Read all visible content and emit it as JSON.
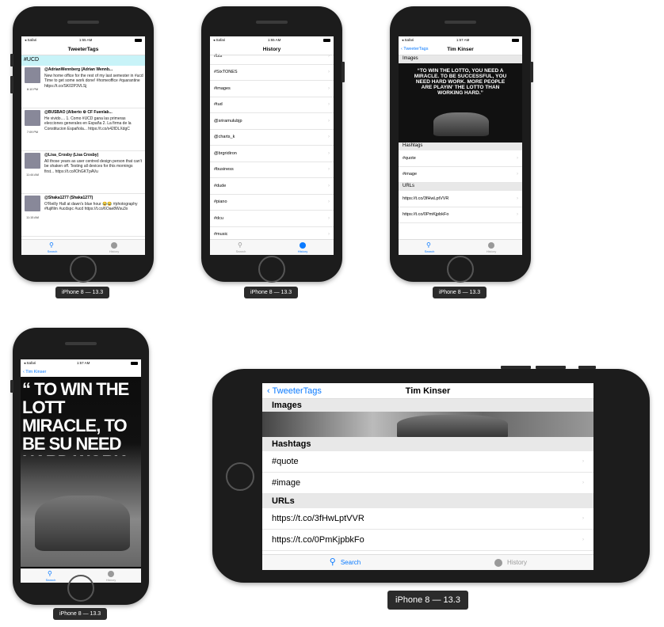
{
  "caption": "iPhone 8 — 13.3",
  "status": {
    "left": "◂ Safari",
    "time1": "1:55 AM",
    "time2": "1:57 AM"
  },
  "tabs": {
    "search": "Search",
    "history": "History"
  },
  "search_screen": {
    "title": "TweeterTags",
    "query": "#UCD",
    "tweets": [
      {
        "user": "@AdrianWennberg (Adrian Wennb...",
        "time": "8:10 PM",
        "text": "New home office for the rest of my last semester in #ucd Time to get some work done! #homeoffice #quarantine https://t.co/SK02P3VLSj"
      },
      {
        "user": "@BUSBAO (Alberto ⚙ CF Fuenlab...",
        "time": "7:09 PM",
        "text": "He vivido.... 1. Como #UCD gana las primeras elecciones generales en España 2. La firma de la Constitucion Española... https://t.co/x42lDLXdgC"
      },
      {
        "user": "@Lisa_Crosby (Lisa Crosby)",
        "time": "11:44 AM",
        "text": "All those years as user centred design person that can't be shaken off. Testing all devices for this mornings first... https://t.co/lOhGKTpAVu"
      },
      {
        "user": "@Shaka1277 (Shaka1277)",
        "time": "11:15 AM",
        "text": "O'Reilly Hall at dawn's blue hour 😂😂 #photography #fujifilm #ucdspc #ucd https://t.co/6Oae8Wsu3x"
      }
    ]
  },
  "history_screen": {
    "title": "History",
    "items": [
      "#bts",
      "#SixTONES",
      "#images",
      "#tud",
      "@sriramulubjp",
      "@charts_k",
      "@brgridiron",
      "#business",
      "#dude",
      "#piano",
      "#dcu",
      "#music",
      "#youtube"
    ]
  },
  "detail_screen": {
    "back": "TweeterTags",
    "title": "Tim Kinser",
    "images_header": "Images",
    "hashtags_header": "Hashtags",
    "hashtags": [
      "#quote",
      "#image"
    ],
    "urls_header": "URLs",
    "urls": [
      "https://t.co/3fHwLptVVR",
      "https://t.co/0PmKjpbkFo"
    ],
    "quote": "“TO WIN THE LOTTO, YOU NEED A MIRACLE. TO BE SUCCESSFUL, YOU NEED HARD WORK. MORE PEOPLE ARE PLAYIN' THE LOTTO THAN WORKING HARD.”"
  },
  "image_screen": {
    "back": "Tim Kinser",
    "quote": "“ TO WIN THE LOTT MIRACLE, TO BE SU NEED HARD WORK. LAYIN' THE LOTTO TH"
  },
  "colors": {
    "accent": "#0a7aff",
    "search_bg": "#c8f3f8",
    "link": "#e0201a",
    "phone": "#1c1c1c"
  }
}
